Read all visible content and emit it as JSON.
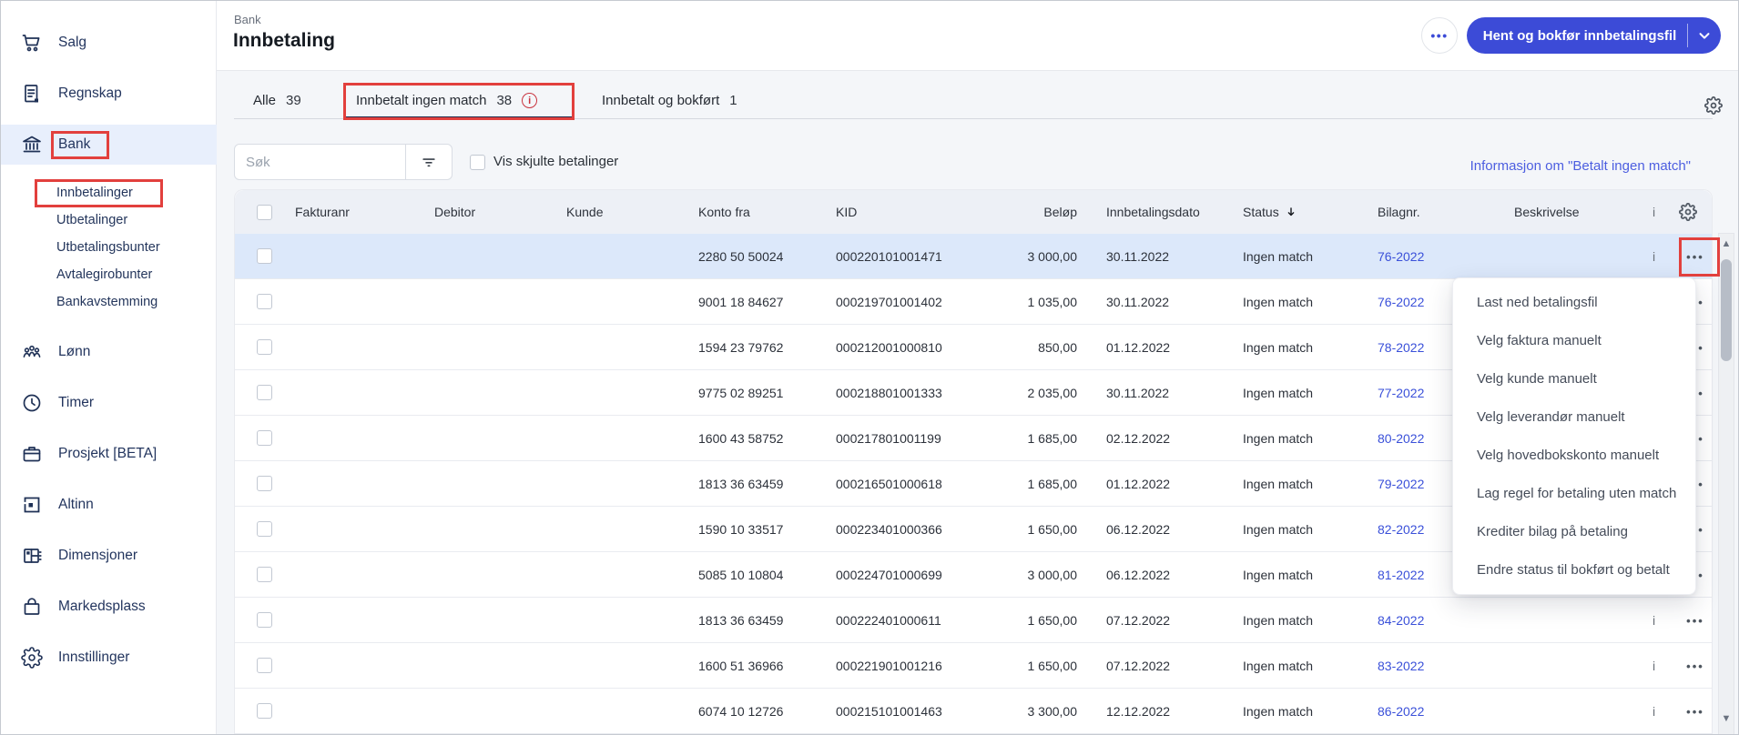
{
  "colors": {
    "primary_blue": "#3c4bd7",
    "link_blue": "#4c5ee0",
    "annotation_red": "#e2403d",
    "info_icon_red": "#c9343f",
    "row_highlight": "#dce8fa",
    "sidebar_navy": "#23355e"
  },
  "sidebar": {
    "items": [
      {
        "label": "Salg",
        "icon": "cart-icon"
      },
      {
        "label": "Regnskap",
        "icon": "document-icon"
      },
      {
        "label": "Bank",
        "icon": "bank-icon",
        "active": true,
        "annotated": true
      },
      {
        "label": "Lønn",
        "icon": "people-icon"
      },
      {
        "label": "Timer",
        "icon": "clock-icon"
      },
      {
        "label": "Prosjekt [BETA]",
        "icon": "briefcase-icon"
      },
      {
        "label": "Altinn",
        "icon": "altinn-icon"
      },
      {
        "label": "Dimensjoner",
        "icon": "grid-icon"
      },
      {
        "label": "Markedsplass",
        "icon": "bag-icon"
      },
      {
        "label": "Innstillinger",
        "icon": "gear-icon"
      }
    ],
    "bank_subitems": [
      {
        "label": "Innbetalinger",
        "annotated": true
      },
      {
        "label": "Utbetalinger"
      },
      {
        "label": "Utbetalingsbunter"
      },
      {
        "label": "Avtalegirobunter"
      },
      {
        "label": "Bankavstemming"
      }
    ]
  },
  "header": {
    "breadcrumb": "Bank",
    "title": "Innbetaling",
    "more_button": "•••",
    "primary_button": "Hent og bokfør innbetalingsfil"
  },
  "tabs": [
    {
      "label": "Alle",
      "count": "39"
    },
    {
      "label": "Innbetalt ingen match",
      "count": "38",
      "has_info_icon": true,
      "active": true,
      "annotated": true
    },
    {
      "label": "Innbetalt og bokført",
      "count": "1"
    }
  ],
  "filters": {
    "search_placeholder": "Søk",
    "show_hidden_label": "Vis skjulte betalinger",
    "info_link": "Informasjon om \"Betalt ingen match\""
  },
  "table": {
    "columns": {
      "fakturanr": "Fakturanr",
      "debitor": "Debitor",
      "kunde": "Kunde",
      "konto_fra": "Konto fra",
      "kid": "KID",
      "belop": "Beløp",
      "dato": "Innbetalingsdato",
      "status": "Status",
      "bilagnr": "Bilagnr.",
      "beskrivelse": "Beskrivelse"
    },
    "sort_column": "Status",
    "sort_direction": "descending",
    "truncated_marker": "i",
    "row_actions_icon": "•••",
    "rows": [
      {
        "fakturanr": "",
        "debitor": "",
        "kunde": "",
        "konto_fra": "2280 50 50024",
        "kid": "000220101001471",
        "belop": "3 000,00",
        "dato": "30.11.2022",
        "status": "Ingen match",
        "bilag": "76-2022",
        "beskrivelse": "",
        "row_class": "selected"
      },
      {
        "fakturanr": "",
        "debitor": "",
        "kunde": "",
        "konto_fra": "9001 18 84627",
        "kid": "000219701001402",
        "belop": "1 035,00",
        "dato": "30.11.2022",
        "status": "Ingen match",
        "bilag": "76-2022",
        "beskrivelse": "",
        "row_class": ""
      },
      {
        "fakturanr": "",
        "debitor": "",
        "kunde": "",
        "konto_fra": "1594 23 79762",
        "kid": "000212001000810",
        "belop": "850,00",
        "dato": "01.12.2022",
        "status": "Ingen match",
        "bilag": "78-2022",
        "beskrivelse": "",
        "row_class": ""
      },
      {
        "fakturanr": "",
        "debitor": "",
        "kunde": "",
        "konto_fra": "9775 02 89251",
        "kid": "000218801001333",
        "belop": "2 035,00",
        "dato": "30.11.2022",
        "status": "Ingen match",
        "bilag": "77-2022",
        "beskrivelse": "",
        "row_class": ""
      },
      {
        "fakturanr": "",
        "debitor": "",
        "kunde": "",
        "konto_fra": "1600 43 58752",
        "kid": "000217801001199",
        "belop": "1 685,00",
        "dato": "02.12.2022",
        "status": "Ingen match",
        "bilag": "80-2022",
        "beskrivelse": "",
        "row_class": ""
      },
      {
        "fakturanr": "",
        "debitor": "",
        "kunde": "",
        "konto_fra": "1813 36 63459",
        "kid": "000216501000618",
        "belop": "1 685,00",
        "dato": "01.12.2022",
        "status": "Ingen match",
        "bilag": "79-2022",
        "beskrivelse": "",
        "row_class": ""
      },
      {
        "fakturanr": "",
        "debitor": "",
        "kunde": "",
        "konto_fra": "1590 10 33517",
        "kid": "000223401000366",
        "belop": "1 650,00",
        "dato": "06.12.2022",
        "status": "Ingen match",
        "bilag": "82-2022",
        "beskrivelse": "",
        "row_class": ""
      },
      {
        "fakturanr": "",
        "debitor": "",
        "kunde": "",
        "konto_fra": "5085 10 10804",
        "kid": "000224701000699",
        "belop": "3 000,00",
        "dato": "06.12.2022",
        "status": "Ingen match",
        "bilag": "81-2022",
        "beskrivelse": "",
        "row_class": ""
      },
      {
        "fakturanr": "",
        "debitor": "",
        "kunde": "",
        "konto_fra": "1813 36 63459",
        "kid": "000222401000611",
        "belop": "1 650,00",
        "dato": "07.12.2022",
        "status": "Ingen match",
        "bilag": "84-2022",
        "beskrivelse": "",
        "row_class": ""
      },
      {
        "fakturanr": "",
        "debitor": "",
        "kunde": "",
        "konto_fra": "1600 51 36966",
        "kid": "000221901001216",
        "belop": "1 650,00",
        "dato": "07.12.2022",
        "status": "Ingen match",
        "bilag": "83-2022",
        "beskrivelse": "",
        "row_class": ""
      },
      {
        "fakturanr": "",
        "debitor": "",
        "kunde": "",
        "konto_fra": "6074 10 12726",
        "kid": "000215101001463",
        "belop": "3 300,00",
        "dato": "12.12.2022",
        "status": "Ingen match",
        "bilag": "86-2022",
        "beskrivelse": "",
        "row_class": ""
      }
    ]
  },
  "context_menu": {
    "items": [
      "Last ned betalingsfil",
      "Velg faktura manuelt",
      "Velg kunde manuelt",
      "Velg leverandør manuelt",
      "Velg hovedbokskonto manuelt",
      "Lag regel for betaling uten match",
      "Krediter bilag på betaling",
      "Endre status til bokført og betalt"
    ]
  }
}
